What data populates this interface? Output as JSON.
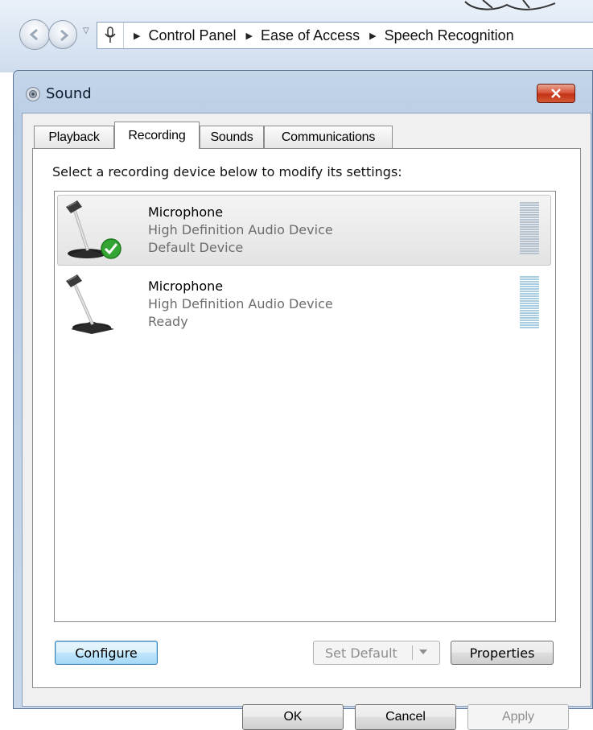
{
  "explorer": {
    "breadcrumb": [
      {
        "label": "Control Panel"
      },
      {
        "label": "Ease of Access"
      },
      {
        "label": "Speech Recognition"
      }
    ]
  },
  "window": {
    "title": "Sound",
    "tabs": [
      {
        "label": "Playback",
        "active": false
      },
      {
        "label": "Recording",
        "active": true
      },
      {
        "label": "Sounds",
        "active": false
      },
      {
        "label": "Communications",
        "active": false
      }
    ],
    "instruction": "Select a recording device below to modify its settings:",
    "devices": [
      {
        "name": "Microphone",
        "description": "High Definition Audio Device",
        "status": "Default Device",
        "selected": true,
        "default_badge": "check-icon"
      },
      {
        "name": "Microphone",
        "description": "High Definition Audio Device",
        "status": "Ready",
        "selected": false
      }
    ],
    "buttons": {
      "configure": "Configure",
      "set_default": "Set Default",
      "properties": "Properties",
      "ok": "OK",
      "cancel": "Cancel",
      "apply": "Apply"
    }
  },
  "colors": {
    "close_button": "#c9462b",
    "selection_bg": "#e8e8e8",
    "default_badge": "#33a532"
  }
}
